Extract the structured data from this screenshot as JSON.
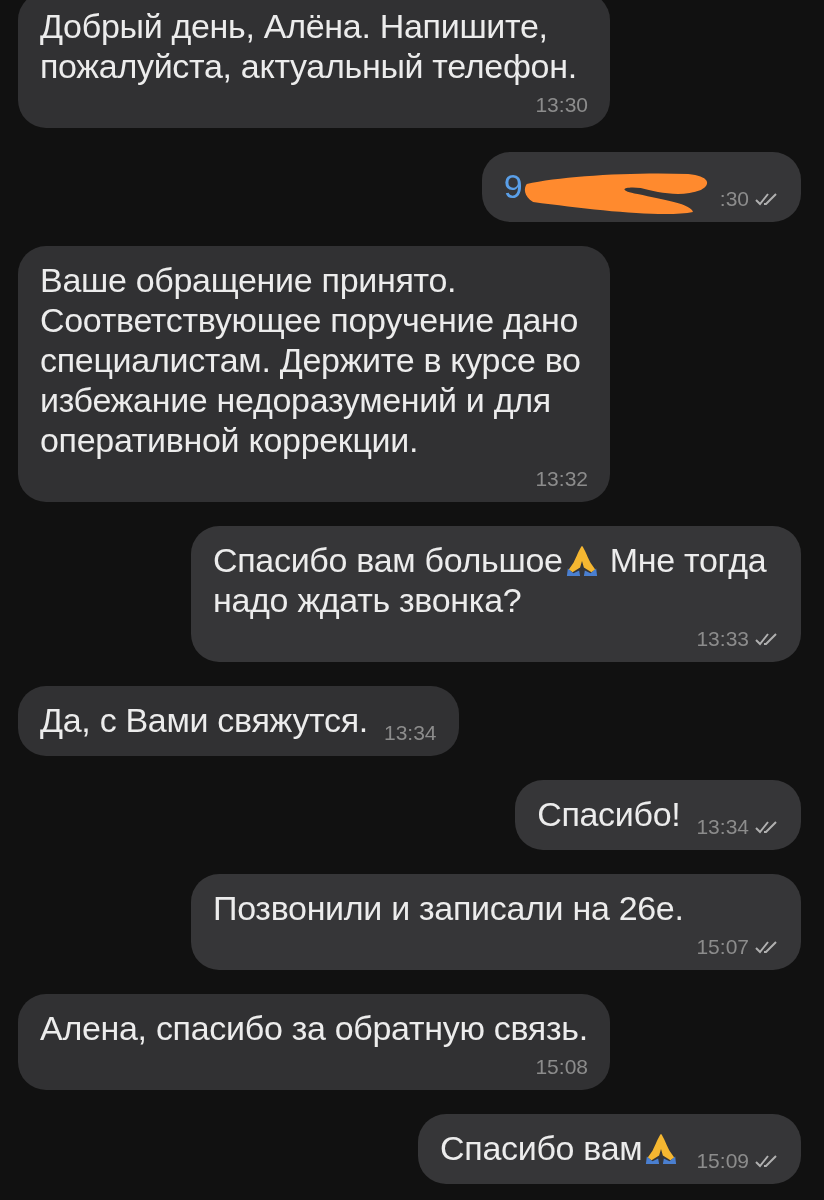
{
  "messages": [
    {
      "outgoing": false,
      "parts": [
        {
          "kind": "text",
          "text": "Добрый день, Алёна. Напишите, пожалуйста, актуальный телефон."
        }
      ],
      "time": "13:30"
    },
    {
      "outgoing": true,
      "redacted": true,
      "parts": [
        {
          "kind": "link",
          "text": "9"
        }
      ],
      "time": ":30",
      "read": true
    },
    {
      "outgoing": false,
      "parts": [
        {
          "kind": "text",
          "text": "Ваше обращение принято. Соответствующее поручение дано специалистам. Держите в курсе во избежание недоразумений и для оперативной коррекции."
        }
      ],
      "time": "13:32"
    },
    {
      "outgoing": true,
      "parts": [
        {
          "kind": "text",
          "text": "Спасибо вам большое"
        },
        {
          "kind": "emoji"
        },
        {
          "kind": "text",
          "text": " Мне тогда надо ждать звонка?"
        }
      ],
      "time": "13:33",
      "read": true
    },
    {
      "outgoing": false,
      "parts": [
        {
          "kind": "text",
          "text": "Да, с Вами свяжутся."
        }
      ],
      "time": "13:34"
    },
    {
      "outgoing": true,
      "parts": [
        {
          "kind": "text",
          "text": "Спасибо!"
        }
      ],
      "time": "13:34",
      "read": true
    },
    {
      "outgoing": true,
      "parts": [
        {
          "kind": "text",
          "text": "Позвонили и записали на 26е."
        }
      ],
      "time": "15:07",
      "read": true
    },
    {
      "outgoing": false,
      "parts": [
        {
          "kind": "text",
          "text": "Алена, спасибо за обратную связь."
        }
      ],
      "time": "15:08"
    },
    {
      "outgoing": true,
      "parts": [
        {
          "kind": "text",
          "text": "Спасибо вам"
        },
        {
          "kind": "emoji"
        }
      ],
      "time": "15:09",
      "read": true
    }
  ]
}
